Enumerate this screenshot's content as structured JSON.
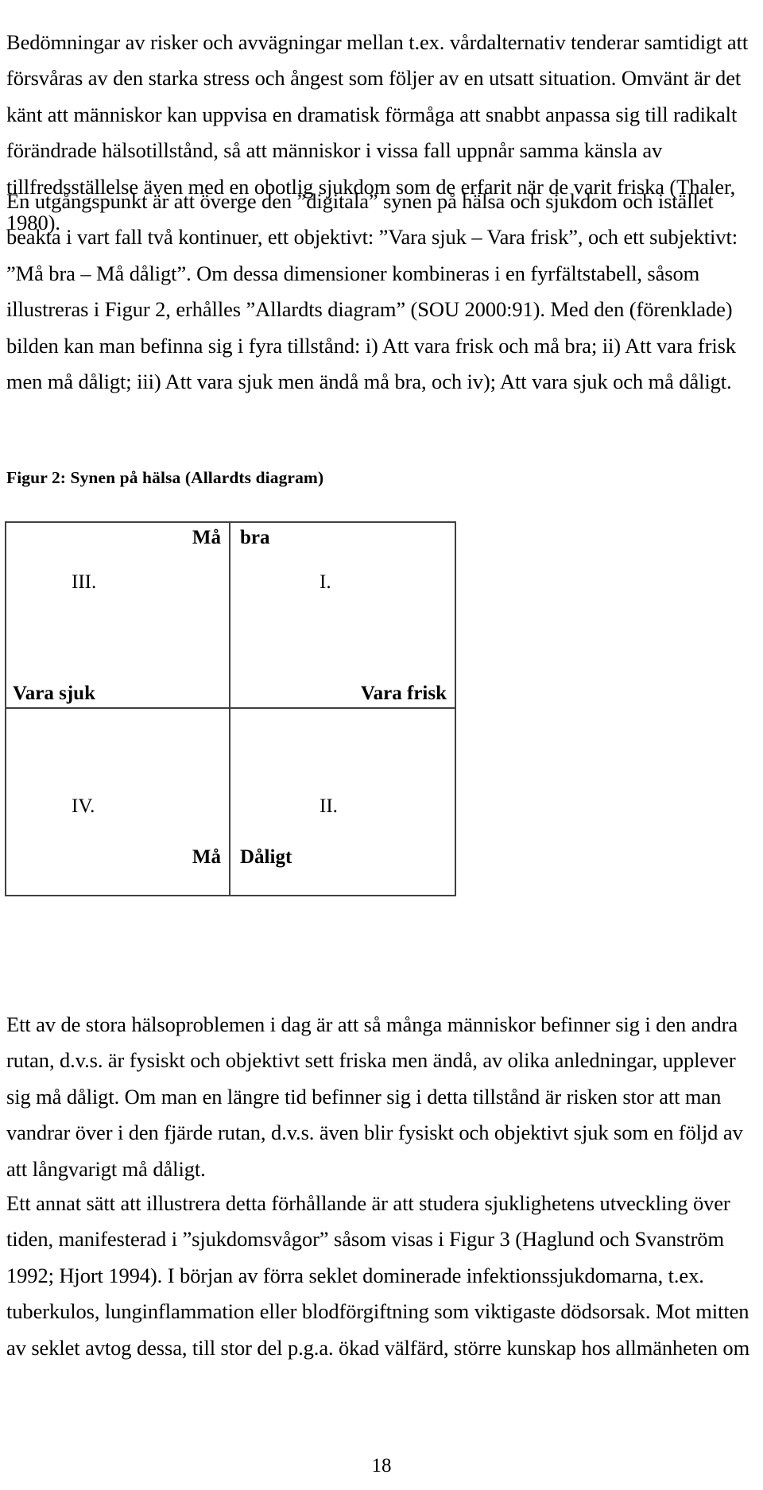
{
  "document": {
    "page_number": "18",
    "paragraphs": {
      "p1": "Bedömningar av risker och avvägningar mellan t.ex. vårdalternativ tenderar samtidigt att försvåras av den starka stress och ångest som följer av en utsatt situation. Omvänt är det känt att människor kan uppvisa en dramatisk förmåga att snabbt anpassa sig till radikalt förändrade hälsotillstånd, så att människor i vissa fall uppnår samma känsla av tillfredsställelse även med en obotlig sjukdom som de erfarit när de varit friska (Thaler, 1980).",
      "p2": "En utgångspunkt är att överge den ”digitala” synen på hälsa och sjukdom och istället beakta i vart fall två kontinuer, ett objektivt: ”Vara sjuk – Vara frisk”, och ett subjektivt: ”Må bra – Må dåligt”. Om dessa dimensioner kombineras i en fyrfältstabell, såsom illustreras i Figur 2, erhålles ”Allardts diagram” (SOU 2000:91). Med den (förenklade) bilden kan man befinna sig i fyra tillstånd: i) Att vara frisk och må bra; ii) Att vara frisk men må dåligt; iii) Att vara sjuk men ändå må bra, och iv); Att vara sjuk och må dåligt.",
      "p4": "Ett av de stora hälsoproblemen i dag är att så många människor befinner sig i den andra rutan, d.v.s. är fysiskt och objektivt sett friska men ändå, av olika anledningar, upplever sig må dåligt. Om man en längre tid befinner sig i detta tillstånd är risken stor att man vandrar över i den fjärde rutan, d.v.s. även blir fysiskt och objektivt sjuk som en följd av att långvarigt må dåligt.",
      "p5": "Ett annat sätt att illustrera detta förhållande är att studera sjuklighetens utveckling över tiden, manifesterad i ”sjukdomsvågor” såsom visas i Figur 3 (Haglund och Svanström 1992; Hjort 1994). I början av förra seklet dominerade infektionssjukdomarna, t.ex. tuberkulos, lunginflammation eller blodförgiftning som viktigaste dödsorsak. Mot mitten av seklet avtog dessa, till stor del p.g.a. ökad välfärd, större kunskap hos allmänheten om"
    }
  },
  "figure": {
    "caption": "Figur 2: Synen på hälsa  (Allardts diagram)",
    "diagram": {
      "axis_labels": {
        "top_left_half": "Må",
        "top_right_half": "bra",
        "middle_left": "Vara sjuk",
        "middle_right": "Vara frisk",
        "bottom_left_half": "Må",
        "bottom_right_half": "Dåligt"
      },
      "quadrants": {
        "top_left": "III.",
        "top_right": "I.",
        "bottom_left": "IV.",
        "bottom_right": "II."
      },
      "border_color": "#404040"
    }
  }
}
